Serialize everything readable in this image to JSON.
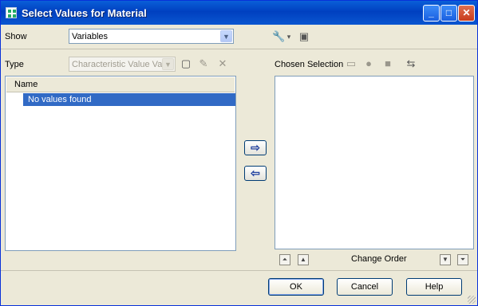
{
  "window": {
    "title": "Select Values for Material",
    "minimize": "_",
    "maximize": "□",
    "close": "✕"
  },
  "show": {
    "label": "Show",
    "value": "Variables",
    "arrow": "▼",
    "icon_wrench": "🔧",
    "icon_doc": "▣",
    "dropdown_mark": "▾"
  },
  "type": {
    "label": "Type",
    "value": "Characteristic Value Va",
    "arrow": "▼",
    "new_icon": "▢",
    "edit_icon": "✎",
    "delete_icon": "✕"
  },
  "left_list": {
    "column_header": "Name",
    "rows": [
      "No values found"
    ]
  },
  "right": {
    "label": "Chosen Selection",
    "save_icon": "▭",
    "circle_icon": "●",
    "stop_icon": "■",
    "swap_icon": "⇆"
  },
  "move": {
    "right": "⇨",
    "left": "⇦"
  },
  "order": {
    "label": "Change Order",
    "top": "⏶",
    "up": "▲",
    "down": "▼",
    "bottom": "⏷"
  },
  "footer": {
    "ok": "OK",
    "cancel": "Cancel",
    "help": "Help"
  },
  "colors": {
    "title_bar": "#0a56d0",
    "selection": "#316ac5",
    "chrome": "#ece9d8"
  }
}
